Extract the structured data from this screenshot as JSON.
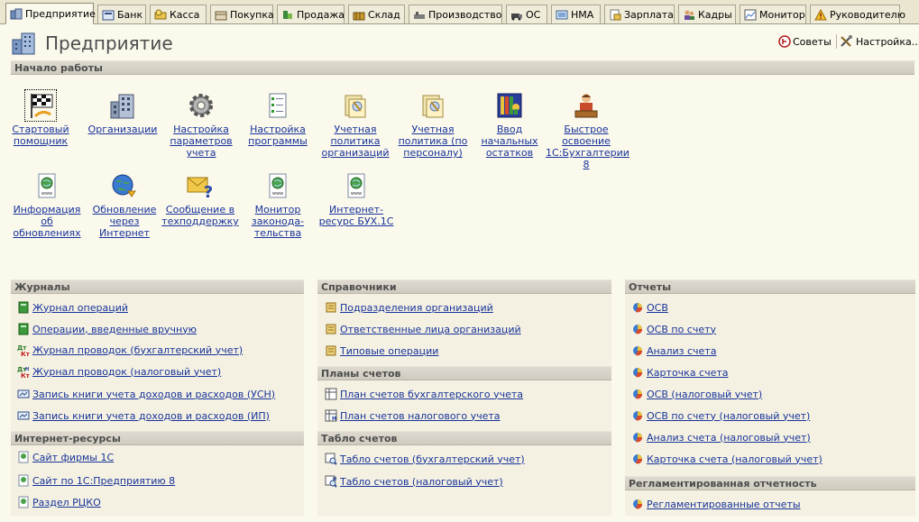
{
  "tabs": [
    {
      "label": "Предприятие",
      "icon": "enterprise-icon"
    },
    {
      "label": "Банк",
      "icon": "bank-icon"
    },
    {
      "label": "Касса",
      "icon": "cash-icon"
    },
    {
      "label": "Покупка",
      "icon": "purchase-icon"
    },
    {
      "label": "Продажа",
      "icon": "sale-icon"
    },
    {
      "label": "Склад",
      "icon": "warehouse-icon"
    },
    {
      "label": "Производство",
      "icon": "production-icon"
    },
    {
      "label": "ОС",
      "icon": "fixed-assets-icon"
    },
    {
      "label": "НМА",
      "icon": "intangible-icon"
    },
    {
      "label": "Зарплата",
      "icon": "salary-icon"
    },
    {
      "label": "Кадры",
      "icon": "staff-icon"
    },
    {
      "label": "Монитор",
      "icon": "monitor-icon"
    },
    {
      "label": "Руководителю",
      "icon": "warning-icon"
    }
  ],
  "header": {
    "title": "Предприятие",
    "tips_label": "Советы",
    "settings_label": "Настройка..."
  },
  "start": {
    "title": "Начало работы",
    "items": [
      "Стартовый помощник",
      "Организации",
      "Настройка параметров учета",
      "Настройка программы",
      "Учетная политика организаций",
      "Учетная политика (по персоналу)",
      "Ввод начальных остатков",
      "Быстрое освоение 1С:Бухгалтерии 8",
      "Информация об обновлениях",
      "Обновление через Интернет",
      "Сообщение в техподдержку",
      "Монитор законода-тельства",
      "Интернет-ресурс БУХ.1С"
    ]
  },
  "journals": {
    "title": "Журналы",
    "items": [
      "Журнал операций",
      "Операции, введенные вручную",
      "Журнал проводок (бухгалтерский учет)",
      "Журнал проводок (налоговый учет)",
      "Запись книги учета доходов и расходов (УСН)",
      "Запись книги учета доходов и расходов (ИП)"
    ]
  },
  "internet": {
    "title": "Интернет-ресурсы",
    "items": [
      "Сайт фирмы 1С",
      "Сайт по 1С:Предприятию 8",
      "Раздел РЦКО"
    ]
  },
  "catalogs": {
    "title": "Справочники",
    "items": [
      "Подразделения организаций",
      "Ответственные лица организаций",
      "Типовые операции"
    ]
  },
  "charts": {
    "title": "Планы счетов",
    "items": [
      "План счетов бухгалтерского учета",
      "План счетов налогового учета"
    ]
  },
  "boards": {
    "title": "Табло счетов",
    "items": [
      "Табло счетов (бухгалтерский учет)",
      "Табло счетов (налоговый учет)"
    ]
  },
  "reports": {
    "title": "Отчеты",
    "items": [
      "ОСВ",
      "ОСВ по счету",
      "Анализ счета",
      "Карточка счета",
      "ОСВ (налоговый учет)",
      "ОСВ по счету (налоговый учет)",
      "Анализ счета (налоговый учет)",
      "Карточка счета (налоговый учет)"
    ]
  },
  "regulated": {
    "title": "Регламентированная отчетность",
    "items": [
      "Регламентированные отчеты"
    ]
  }
}
